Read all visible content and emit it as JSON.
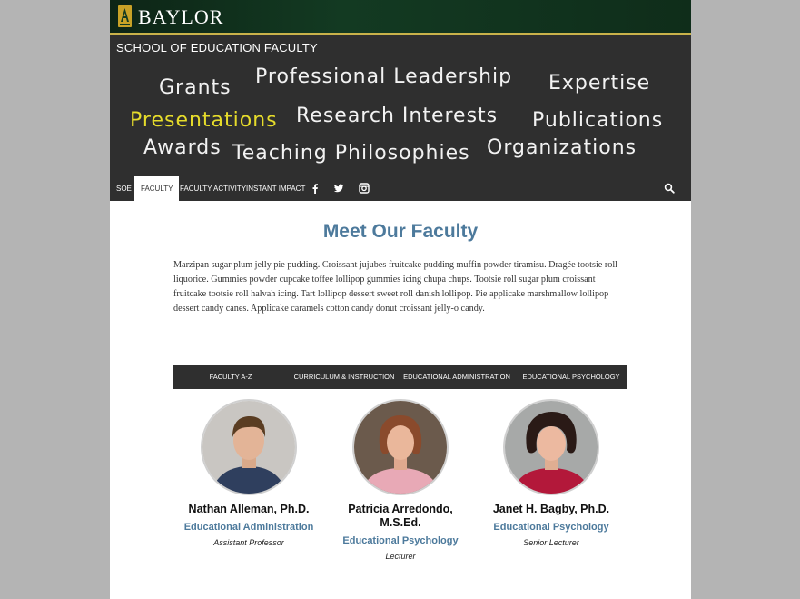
{
  "brand": {
    "name": "BAYLOR",
    "logo_icon": "baylor-shield-icon"
  },
  "header": {
    "school_title": "SCHOOL OF EDUCATION FACULTY",
    "words": {
      "grants": "Grants",
      "professional_leadership": "Professional Leadership",
      "expertise": "Expertise",
      "presentations": "Presentations",
      "research_interests": "Research Interests",
      "publications": "Publications",
      "awards": "Awards",
      "teaching_philosophies": "Teaching Philosophies",
      "organizations": "Organizations"
    },
    "highlight_color": "#e6dc2b"
  },
  "nav": {
    "items": [
      "SOE",
      "FACULTY",
      "FACULTY ACTIVITY",
      "INSTANT IMPACT"
    ],
    "active": "FACULTY",
    "icons": [
      "facebook-icon",
      "twitter-icon",
      "instagram-icon",
      "search-icon"
    ]
  },
  "main": {
    "title": "Meet Our Faculty",
    "intro": "Marzipan sugar plum jelly pie pudding. Croissant jujubes fruitcake pudding muffin powder tiramisu. Dragée tootsie roll liquorice. Gummies powder cupcake toffee lollipop gummies icing chupa chups. Tootsie roll sugar plum croissant fruitcake tootsie roll halvah icing. Tart lollipop dessert sweet roll danish lollipop. Pie applicake marshmallow lollipop dessert candy canes. Applicake caramels cotton candy donut croissant jelly-o candy."
  },
  "filter_tabs": [
    "FACULTY A-Z",
    "CURRICULUM & INSTRUCTION",
    "EDUCATIONAL ADMINISTRATION",
    "EDUCATIONAL PSYCHOLOGY"
  ],
  "faculty": [
    {
      "name": "Nathan Alleman, Ph.D.",
      "department": "Educational Administration",
      "role": "Assistant Professor"
    },
    {
      "name": "Patricia Arredondo, M.S.Ed.",
      "department": "Educational Psychology",
      "role": "Lecturer"
    },
    {
      "name": "Janet H. Bagby, Ph.D.",
      "department": "Educational Psychology",
      "role": "Senior Lecturer"
    }
  ],
  "colors": {
    "accent_blue": "#4d7a9c",
    "board": "#2f2f2f",
    "brand_green": "#133a22",
    "gold": "#c9b24a"
  }
}
